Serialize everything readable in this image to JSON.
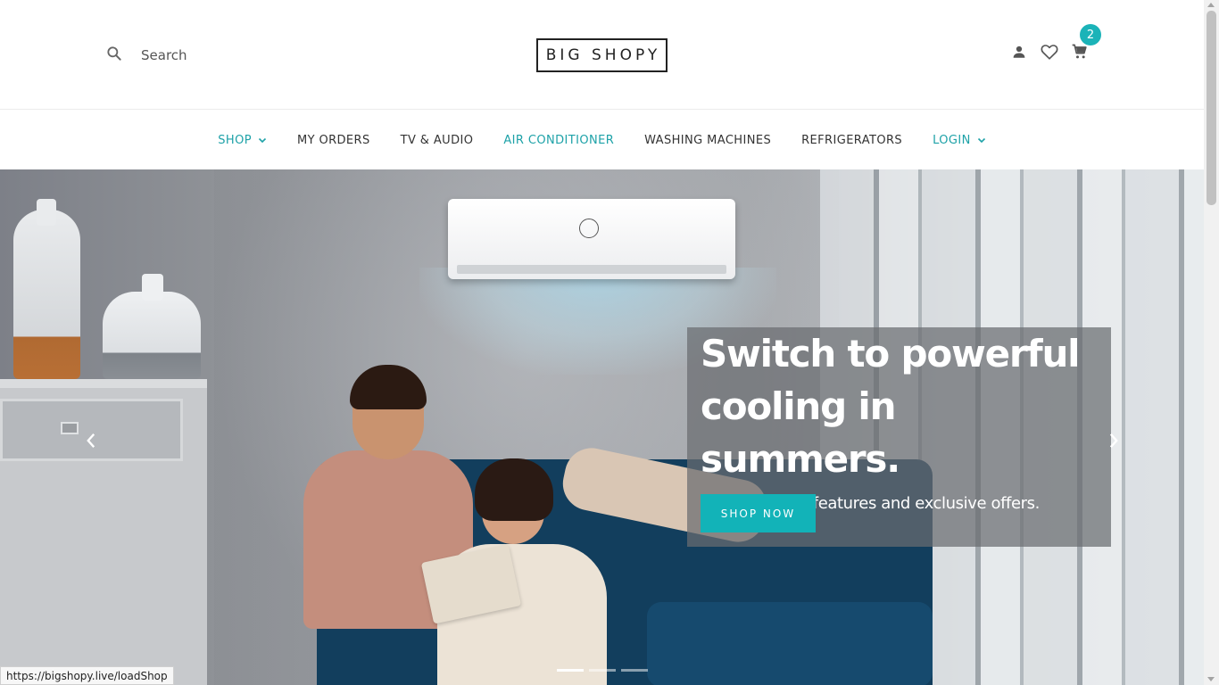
{
  "header": {
    "search_placeholder": "Search",
    "logo_text": "BIG SHOPY",
    "cart_count": "2",
    "icons": [
      "search-icon",
      "user-icon",
      "heart-icon",
      "cart-icon"
    ]
  },
  "nav": {
    "items": [
      {
        "label": "SHOP",
        "has_dropdown": true,
        "color": "#1ea2a8"
      },
      {
        "label": "MY ORDERS",
        "has_dropdown": false
      },
      {
        "label": "TV & AUDIO",
        "has_dropdown": false
      },
      {
        "label": "AIR CONDITIONER",
        "has_dropdown": false,
        "color": "#1ea2a8"
      },
      {
        "label": "WASHING MACHINES",
        "has_dropdown": false
      },
      {
        "label": "REFRIGERATORS",
        "has_dropdown": false
      },
      {
        "label": "LOGIN",
        "has_dropdown": true,
        "color": "#1ea2a8"
      }
    ]
  },
  "hero": {
    "headline": "Switch to powerful cooling in summers.",
    "subtext": "Enjoy exciting features and exclusive offers.",
    "cta_label": "SHOP NOW",
    "slide_count": 3,
    "active_slide": 1
  },
  "status_url": "https://bigshopy.live/loadShop",
  "colors": {
    "accent": "#12b3b8",
    "nav_active": "#1ea2a8"
  }
}
